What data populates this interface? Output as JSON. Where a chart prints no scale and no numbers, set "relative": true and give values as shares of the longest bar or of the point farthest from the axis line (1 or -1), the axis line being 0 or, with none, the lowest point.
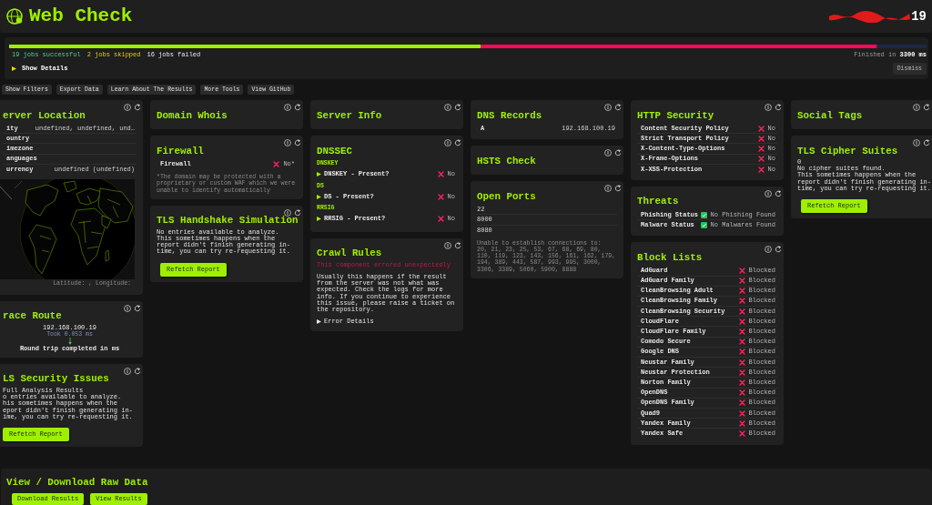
{
  "header": {
    "title": "Web Check",
    "host": "19"
  },
  "progress": {
    "chart_data": {
      "type": "bar",
      "orientation": "horizontal",
      "stacked": true,
      "relative": true,
      "series": [
        {
          "color": "#9fef00",
          "values": [
            0.514
          ]
        },
        {
          "color": "#ff0a5a",
          "values": [
            0.432
          ]
        },
        {
          "color": "#1c2748",
          "values": [
            0.054
          ]
        }
      ]
    },
    "summary": [
      {
        "kind": "success",
        "text": "19 jobs successful"
      },
      {
        "kind": "skipped",
        "text": "2 jobs skipped"
      },
      {
        "kind": "failed",
        "text": "16 jobs failed"
      }
    ],
    "finished": "Finished in **3300 ms**",
    "details": {
      "label": "Show Details",
      "expanded": false
    },
    "dismiss": "Dismiss"
  },
  "toolbar": [
    "Show Filters",
    "Export Data",
    "Learn About The Results",
    "More Tools",
    "View GitHub"
  ],
  "columns": [
    [
      {
        "title": "erver Location",
        "blocks": [
          {
            "kind": "kv",
            "rows": [
              {
                "label": "ity",
                "value": "undefined, undefined, und…"
              },
              {
                "label": "ountry"
              },
              {
                "label": "imezone"
              },
              {
                "label": "anguages"
              },
              {
                "label": "urrency",
                "value": "undefined (undefined)"
              }
            ]
          },
          {
            "kind": "map",
            "caption": "Latitude: , Longitude:"
          }
        ]
      },
      {
        "title": "race Route",
        "blocks": [
          {
            "kind": "trace",
            "host": "192.168.100.19",
            "took": "Took 0.053 ms",
            "result": "Round trip completed in ms"
          }
        ]
      },
      {
        "title": "LS Security Issues",
        "blocks": [
          {
            "kind": "text",
            "text": "Full Analysis Results"
          },
          {
            "kind": "text",
            "text": "o entries available to analyze.\nhis sometimes happens when the\neport didn't finish generating in-\nime, you can try re-requesting it."
          },
          {
            "kind": "button",
            "text": "Refetch Report"
          }
        ]
      }
    ],
    [
      {
        "title": "Domain Whois"
      },
      {
        "title": "Firewall",
        "blocks": [
          {
            "kind": "status",
            "rows": [
              {
                "label": "Firewall",
                "ok": false,
                "value": "No*"
              }
            ]
          },
          {
            "kind": "note",
            "text": "*The domain may be protected with a proprietary or custom WAF which we were unable to identify automatically"
          }
        ]
      },
      {
        "title": "TLS Handshake Simulation",
        "blocks": [
          {
            "kind": "text",
            "text": "No entries available to analyze.\nThis sometimes happens when the report didn't finish generating in-time, you can try re-requesting it."
          },
          {
            "kind": "button",
            "text": "Refetch Report"
          }
        ]
      }
    ],
    [
      {
        "title": "Server Info"
      },
      {
        "title": "DNSSEC",
        "blocks": [
          {
            "kind": "label",
            "text": "DNSKEY"
          },
          {
            "kind": "status",
            "rows": [
              {
                "label": "DNSKEY - Present?",
                "expanded": false,
                "ok": false,
                "value": "No"
              }
            ]
          },
          {
            "kind": "label",
            "text": "DS"
          },
          {
            "kind": "status",
            "rows": [
              {
                "label": "DS - Present?",
                "expanded": false,
                "ok": false,
                "value": "No"
              }
            ]
          },
          {
            "kind": "label",
            "text": "RRSIG"
          },
          {
            "kind": "status",
            "rows": [
              {
                "label": "RRSIG - Present?",
                "expanded": false,
                "ok": false,
                "value": "No"
              }
            ]
          }
        ]
      },
      {
        "title": "Crawl Rules",
        "blocks": [
          {
            "kind": "error",
            "text": "This component errored unexpectedly"
          },
          {
            "kind": "text",
            "text": "Usually this happens if the result from the server was not what was expected. Check the logs for more info. If you continue to experience this issue, please raise a ticket on the repository."
          },
          {
            "kind": "disclosure",
            "text": "Error Details",
            "expanded": false
          }
        ]
      }
    ],
    [
      {
        "title": "DNS Records",
        "blocks": [
          {
            "kind": "kv",
            "rows": [
              {
                "label": "A",
                "value": "192.168.100.19"
              }
            ]
          }
        ]
      },
      {
        "title": "HSTS Check"
      },
      {
        "title": "Open Ports",
        "blocks": [
          {
            "kind": "list",
            "items": [
              "22",
              "8000",
              "8080"
            ]
          },
          {
            "kind": "note",
            "text": "Unable to establish connections to:\n20, 21, 23, 25, 53, 67, 68, 69, 80, 110, 119, 123, 143, 156, 161, 162, 179, 194, 389, 443, 587, 993, 995, 3000, 3306, 3389, 5060, 5900, 8888"
          }
        ]
      }
    ],
    [
      {
        "title": "HTTP Security",
        "blocks": [
          {
            "kind": "status",
            "rows": [
              {
                "label": "Content Security Policy",
                "ok": false,
                "value": "No"
              },
              {
                "label": "Strict Transport Policy",
                "ok": false,
                "value": "No"
              },
              {
                "label": "X-Content-Type-Options",
                "ok": false,
                "value": "No"
              },
              {
                "label": "X-Frame-Options",
                "ok": false,
                "value": "No"
              },
              {
                "label": "X-XSS-Protection",
                "ok": false,
                "value": "No"
              }
            ]
          }
        ]
      },
      {
        "title": "Threats",
        "blocks": [
          {
            "kind": "status",
            "rows": [
              {
                "label": "Phishing Status",
                "ok": true,
                "value": "No Phishing Found"
              },
              {
                "label": "Malware Status",
                "ok": true,
                "value": "No Malwares Found"
              }
            ]
          }
        ]
      },
      {
        "title": "Block Lists",
        "blocks": [
          {
            "kind": "status",
            "rows": [
              {
                "label": "AdGuard",
                "ok": false,
                "value": "Blocked"
              },
              {
                "label": "AdGuard Family",
                "ok": false,
                "value": "Blocked"
              },
              {
                "label": "CleanBrowsing Adult",
                "ok": false,
                "value": "Blocked"
              },
              {
                "label": "CleanBrowsing Family",
                "ok": false,
                "value": "Blocked"
              },
              {
                "label": "CleanBrowsing Security",
                "ok": false,
                "value": "Blocked"
              },
              {
                "label": "CloudFlare",
                "ok": false,
                "value": "Blocked"
              },
              {
                "label": "CloudFlare Family",
                "ok": false,
                "value": "Blocked"
              },
              {
                "label": "Comodo Secure",
                "ok": false,
                "value": "Blocked"
              },
              {
                "label": "Google DNS",
                "ok": false,
                "value": "Blocked"
              },
              {
                "label": "Neustar Family",
                "ok": false,
                "value": "Blocked"
              },
              {
                "label": "Neustar Protection",
                "ok": false,
                "value": "Blocked"
              },
              {
                "label": "Norton Family",
                "ok": false,
                "value": "Blocked"
              },
              {
                "label": "OpenDNS",
                "ok": false,
                "value": "Blocked"
              },
              {
                "label": "OpenDNS Family",
                "ok": false,
                "value": "Blocked"
              },
              {
                "label": "Quad9",
                "ok": false,
                "value": "Blocked"
              },
              {
                "label": "Yandex Family",
                "ok": false,
                "value": "Blocked"
              },
              {
                "label": "Yandex Safe",
                "ok": false,
                "value": "Blocked"
              }
            ]
          }
        ]
      }
    ],
    [
      {
        "title": "Social Tags"
      },
      {
        "title": "TLS Cipher Suites",
        "blocks": [
          {
            "kind": "text",
            "text": "0"
          },
          {
            "kind": "text",
            "text": "No cipher suites found.\nThis sometimes happens when the report didn't finish generating in-time, you can try re-requesting it."
          },
          {
            "kind": "button",
            "text": "Refetch Report"
          }
        ]
      }
    ]
  ],
  "raw_data": {
    "title": "View / Download Raw Data",
    "buttons": [
      "Download Results",
      "View Results"
    ]
  }
}
